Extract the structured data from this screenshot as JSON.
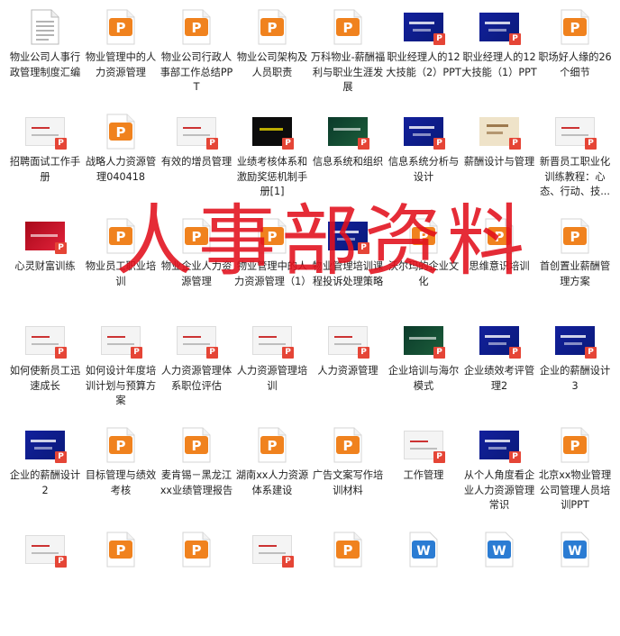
{
  "watermark": "人事部资料",
  "files": [
    {
      "label": "物业公司人事行政管理制度汇编",
      "thumb": "doc"
    },
    {
      "label": "物业管理中的人力资源管理",
      "thumb": "ppt"
    },
    {
      "label": "物业公司行政人事部工作总结PPT",
      "thumb": "ppt"
    },
    {
      "label": "物业公司架构及人员职责",
      "thumb": "ppt"
    },
    {
      "label": "万科物业-薪酬福利与职业生涯发展",
      "thumb": "ppt"
    },
    {
      "label": "职业经理人的12大技能（2）PPT",
      "thumb": "blue"
    },
    {
      "label": "职业经理人的12大技能（1）PPT",
      "thumb": "blue"
    },
    {
      "label": "职场好人缘的26个细节",
      "thumb": "ppt"
    },
    {
      "label": "招聘面试工作手册",
      "thumb": "light"
    },
    {
      "label": "战略人力资源管理040418",
      "thumb": "ppt"
    },
    {
      "label": "有效的增员管理",
      "thumb": "light"
    },
    {
      "label": "业绩考核体系和激励奖惩机制手册[1]",
      "thumb": "dark"
    },
    {
      "label": "信息系统和组织",
      "thumb": "green"
    },
    {
      "label": "信息系统分析与设计",
      "thumb": "blue"
    },
    {
      "label": "薪酬设计与管理",
      "thumb": "beige"
    },
    {
      "label": "新晋员工职业化训练教程：心态、行动、技...",
      "thumb": "light"
    },
    {
      "label": "心灵财富训练",
      "thumb": "red"
    },
    {
      "label": "物业员工职业培训",
      "thumb": "ppt"
    },
    {
      "label": "物业企业人力资源管理",
      "thumb": "ppt"
    },
    {
      "label": "物业管理中的人力资源管理（1）",
      "thumb": "ppt"
    },
    {
      "label": "物业管理培训课程投诉处理策略",
      "thumb": "blue"
    },
    {
      "label": "沃尔玛的企业文化",
      "thumb": "ppt"
    },
    {
      "label": "思维意识培训",
      "thumb": "ppt"
    },
    {
      "label": "首创置业薪酬管理方案",
      "thumb": "ppt"
    },
    {
      "label": "如何使新员工迅速成长",
      "thumb": "light"
    },
    {
      "label": "如何设计年度培训计划与预算方案",
      "thumb": "light"
    },
    {
      "label": "人力资源管理体系职位评估",
      "thumb": "light"
    },
    {
      "label": "人力资源管理培训",
      "thumb": "light"
    },
    {
      "label": "人力资源管理",
      "thumb": "light"
    },
    {
      "label": "企业培训与海尔模式",
      "thumb": "green"
    },
    {
      "label": "企业绩效考评管理2",
      "thumb": "blue"
    },
    {
      "label": "企业的薪酬设计3",
      "thumb": "blue"
    },
    {
      "label": "企业的薪酬设计2",
      "thumb": "blue"
    },
    {
      "label": "目标管理与绩效考核",
      "thumb": "ppt"
    },
    {
      "label": "麦肯锡－黑龙江xx业绩管理报告",
      "thumb": "ppt"
    },
    {
      "label": "湖南xx人力资源体系建设",
      "thumb": "ppt"
    },
    {
      "label": "广告文案写作培训材料",
      "thumb": "ppt"
    },
    {
      "label": "工作管理",
      "thumb": "light"
    },
    {
      "label": "从个人角度看企业人力资源管理常识",
      "thumb": "blue"
    },
    {
      "label": "北京xx物业管理公司管理人员培训PPT",
      "thumb": "ppt"
    },
    {
      "label": "",
      "thumb": "light"
    },
    {
      "label": "",
      "thumb": "ppt"
    },
    {
      "label": "",
      "thumb": "ppt"
    },
    {
      "label": "",
      "thumb": "light"
    },
    {
      "label": "",
      "thumb": "ppt"
    },
    {
      "label": "",
      "thumb": "word"
    },
    {
      "label": "",
      "thumb": "word"
    },
    {
      "label": "",
      "thumb": "word"
    }
  ],
  "colors": {
    "ppt_orange": "#f0821e",
    "badge_red": "#e54536",
    "word_blue": "#2b7cd3",
    "watermark_red": "#e2101c"
  }
}
